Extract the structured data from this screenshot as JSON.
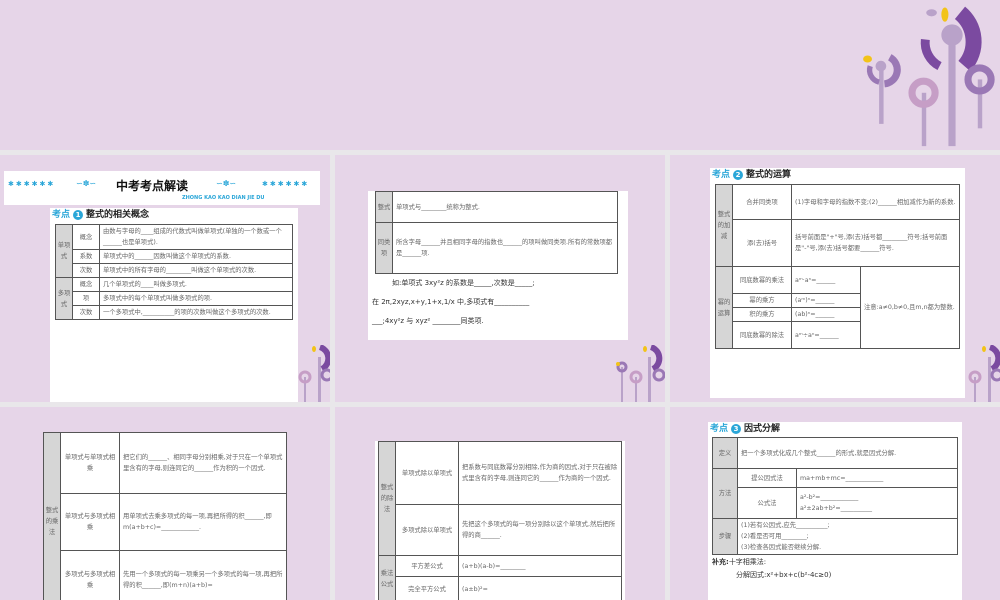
{
  "colors": {
    "background": "#e6d5e8",
    "accent": "#2aa6d8",
    "flower_dark": "#7b4aa0",
    "flower_light": "#b9a2c9",
    "flower_yellow": "#f2c318"
  },
  "slide1": {
    "banner_title": "中考考点解读",
    "banner_sub": "ZHONG KAO KAO DIAN JIE DU",
    "stars": "✱✱✱✱✱✱",
    "kaodian": "考点",
    "num": "1",
    "heading": "整式的相关概念",
    "rows": [
      {
        "group": "单项式",
        "label": "概念",
        "text": "由数与字母的____组成的代数式叫做单项式(单独的一个数或一个______也是单项式)."
      },
      {
        "label": "系数",
        "text": "单项式中的______因数叫做这个单项式的系数."
      },
      {
        "label": "次数",
        "text": "单项式中的所有字母的________叫做这个单项式的次数."
      },
      {
        "group": "多项式",
        "label": "概念",
        "text": "几个单项式的____叫做多项式."
      },
      {
        "label": "项",
        "text": "多项式中的每个单项式叫做多项式的项."
      },
      {
        "label": "次数",
        "text": "一个多项式中,__________的项的次数叫做这个多项式的次数."
      }
    ]
  },
  "slide2": {
    "rows": [
      {
        "label": "整式",
        "text": "单项式与________统称为整式."
      },
      {
        "label": "同类项",
        "text": "所含字母______并且相同字母的指数也______的项叫做同类项.所有的常数项都是______项."
      }
    ],
    "example": [
      "如:单项式 3xy²z 的系数是_____,次数是_____;",
      "在 2π,2xyz,x+y,1+x,1/x 中,多项式有__________",
      "___;4xy²z 与 xyz² ________同类项."
    ]
  },
  "slide3": {
    "kaodian": "考点",
    "num": "2",
    "heading": "整式的运算",
    "add": {
      "group": "整式的加减",
      "rows": [
        {
          "label": "合并同类项",
          "text": "(1)字母和字母的指数不变;(2)______相加减作为新的系数."
        },
        {
          "label": "添(去)括号",
          "text": "括号前面是\"+\"号,添(去)括号都________符号;括号前面是\"-\"号,添(去)括号都要______符号."
        }
      ]
    },
    "power": {
      "group": "幂的运算",
      "note": "注意:a≠0,b≠0,且m,n都为整数.",
      "rows": [
        {
          "label": "同底数幂的乘法",
          "text": "aᵐ·aⁿ=______"
        },
        {
          "label": "幂的乘方",
          "text": "(aᵐ)ⁿ=______"
        },
        {
          "label": "积的乘方",
          "text": "(ab)ⁿ=______"
        },
        {
          "label": "同底数幂的除法",
          "text": "aᵐ÷aⁿ=______"
        }
      ]
    }
  },
  "slide4": {
    "group": "整式的乘法",
    "rows": [
      {
        "label": "单项式与单项式相乘",
        "text": "把它们的______、相同字母分别相乘,对于只在一个单项式里含有的字母,则连同它的______作为积的一个因式."
      },
      {
        "label": "单项式与多项式相乘",
        "text": "用单项式去乘多项式的每一项,再把所得的积______,即 m(a+b+c)=____________."
      },
      {
        "label": "多项式与多项式相乘",
        "text": "先用一个多项式的每一项乘另一个多项式的每一项,再把所得的积______,即(m+n)(a+b)="
      }
    ]
  },
  "slide5": {
    "div": {
      "group": "整式的除法",
      "rows": [
        {
          "label": "单项式除以单项式",
          "text": "把系数与同底数幂分别相除,作为商的因式,对于只在被除式里含有的字母,则连同它的______作为商的一个因式."
        },
        {
          "label": "多项式除以单项式",
          "text": "先把这个多项式的每一项分别除以这个单项式,然后把所得的商______."
        }
      ]
    },
    "formula": {
      "group": "乘法公式",
      "rows": [
        {
          "label": "平方差公式",
          "text": "(a+b)(a-b)=________"
        },
        {
          "label": "完全平方公式",
          "text": "(a±b)²="
        }
      ]
    }
  },
  "slide6": {
    "kaodian": "考点",
    "num": "3",
    "heading": "因式分解",
    "definition": {
      "label": "定义",
      "text": "把一个多项式化成几个整式______的形式,就是因式分解."
    },
    "method": {
      "label": "方法",
      "rows": [
        {
          "label": "提公因式法",
          "text": "ma+mb+mc=____________"
        },
        {
          "label": "公式法",
          "text": "a²-b²=____________",
          "text2": "a²±2ab+b²=__________"
        }
      ]
    },
    "steps": {
      "label": "步骤",
      "items": [
        "(1)若有公因式,应先__________;",
        "(2)看是否可用________;",
        "(3)检查各因式能否继续分解."
      ]
    },
    "supplement_label": "补充:",
    "supplement": "十字相乘法:",
    "supplement_line": "分解因式:x²+bx+c(b²-4c≥0)"
  }
}
